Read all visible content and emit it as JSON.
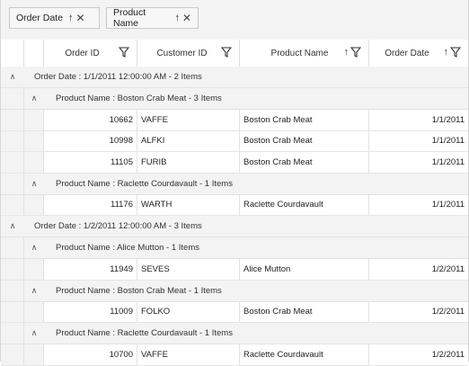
{
  "group_panel": {
    "chips": [
      {
        "label": "Order Date",
        "sort_icon": "arrow-up",
        "close_icon": "close-x"
      },
      {
        "label": "Product Name",
        "sort_icon": "arrow-up",
        "close_icon": "close-x"
      }
    ]
  },
  "columns": [
    {
      "label": "Order ID",
      "icons": [
        "filter-icon"
      ]
    },
    {
      "label": "Customer ID",
      "icons": [
        "filter-icon"
      ]
    },
    {
      "label": "Product Name",
      "icons": [
        "sort-ascending-icon",
        "filter-icon"
      ]
    },
    {
      "label": "Order Date",
      "icons": [
        "sort-ascending-icon",
        "filter-icon"
      ]
    }
  ],
  "groups": [
    {
      "caption": "Order Date : 1/1/2011 12:00:00 AM - 2 Items",
      "subgroups": [
        {
          "caption": "Product Name : Boston Crab Meat - 3 Items",
          "rows": [
            {
              "order_id": "10662",
              "customer_id": "VAFFE",
              "product_name": "Boston Crab Meat",
              "order_date": "1/1/2011"
            },
            {
              "order_id": "10998",
              "customer_id": "ALFKI",
              "product_name": "Boston Crab Meat",
              "order_date": "1/1/2011"
            },
            {
              "order_id": "11105",
              "customer_id": "FURIB",
              "product_name": "Boston Crab Meat",
              "order_date": "1/1/2011"
            }
          ]
        },
        {
          "caption": "Product Name : Raclette Courdavault - 1 Items",
          "rows": [
            {
              "order_id": "11176",
              "customer_id": "WARTH",
              "product_name": "Raclette Courdavault",
              "order_date": "1/1/2011"
            }
          ]
        }
      ]
    },
    {
      "caption": "Order Date : 1/2/2011 12:00:00 AM - 3 Items",
      "subgroups": [
        {
          "caption": "Product Name : Alice Mutton - 1 Items",
          "rows": [
            {
              "order_id": "11949",
              "customer_id": "SEVES",
              "product_name": "Alice Mutton",
              "order_date": "1/2/2011"
            }
          ]
        },
        {
          "caption": "Product Name : Boston Crab Meat - 1 Items",
          "rows": [
            {
              "order_id": "11009",
              "customer_id": "FOLKO",
              "product_name": "Boston Crab Meat",
              "order_date": "1/2/2011"
            }
          ]
        },
        {
          "caption": "Product Name : Raclette Courdavault - 1 Items",
          "rows": [
            {
              "order_id": "10700",
              "customer_id": "VAFFE",
              "product_name": "Raclette Courdavault",
              "order_date": "1/2/2011"
            }
          ]
        }
      ]
    }
  ]
}
